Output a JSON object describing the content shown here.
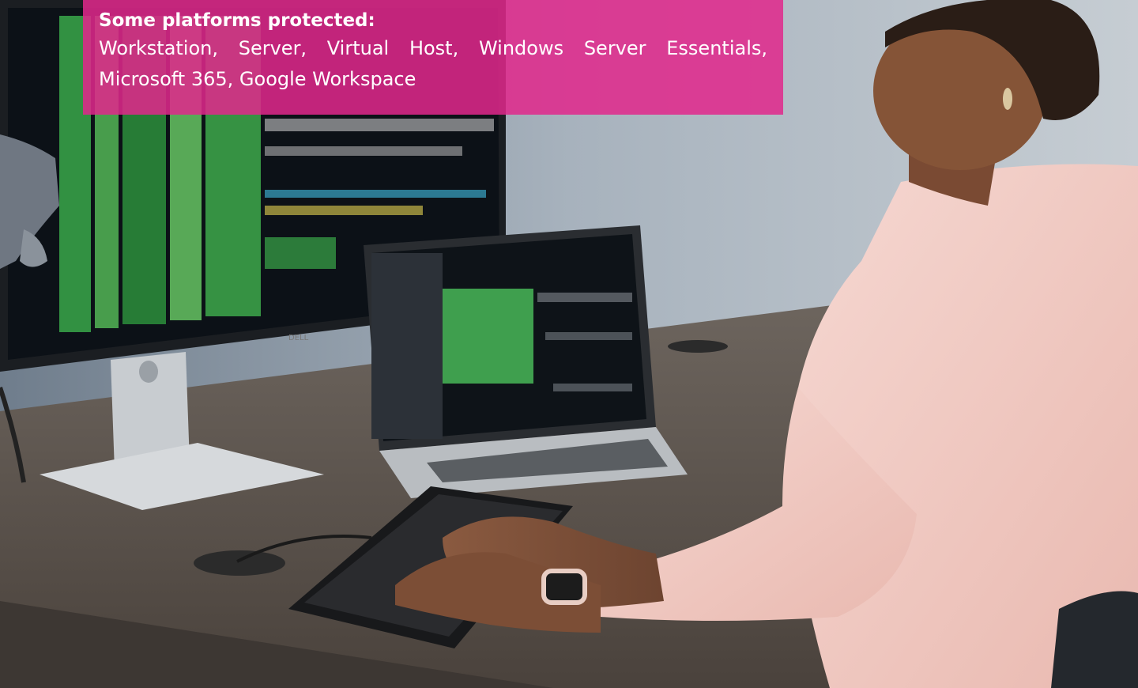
{
  "overlay": {
    "title": "Some platforms protected:",
    "text": "Workstation, Server, Virtual Host, Windows Server Essentials, Microsoft 365, Google Workspace",
    "background_color": "#e1288c"
  },
  "photo": {
    "monitor_brand": "DELL"
  }
}
